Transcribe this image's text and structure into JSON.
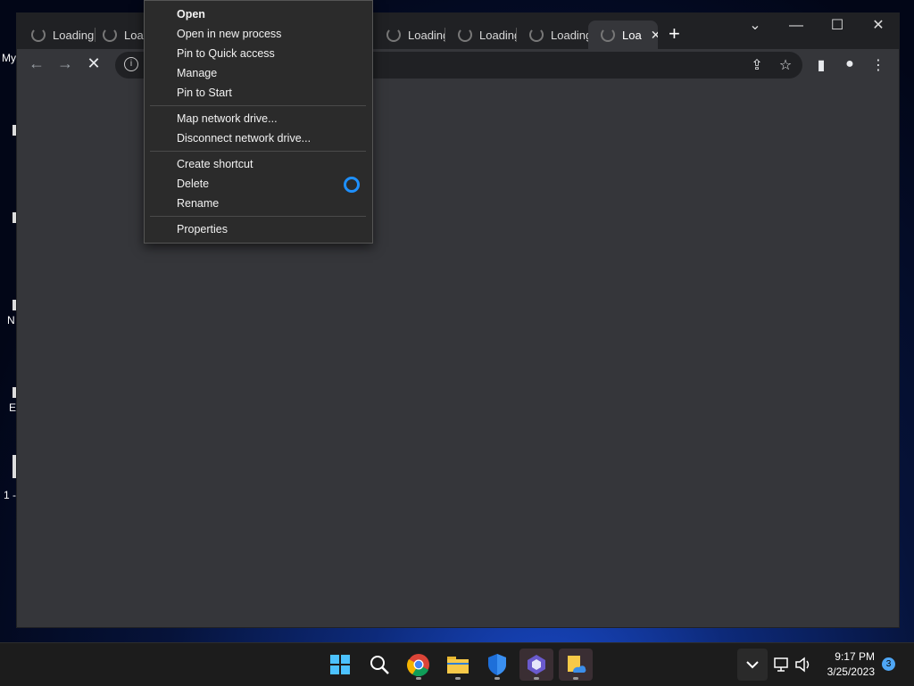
{
  "desktop": {
    "icon_labels": [
      "My",
      "N",
      "E",
      "1 -"
    ]
  },
  "browser": {
    "tabs": [
      {
        "label": "Loading"
      },
      {
        "label": "Load"
      },
      {
        "label": "Loading"
      },
      {
        "label": "Loading"
      },
      {
        "label": "Loading"
      },
      {
        "label": "Loa",
        "active": true
      }
    ],
    "new_tab_glyph": "+",
    "close_glyph": "✕",
    "window_controls": {
      "tab_search": "⌄",
      "minimize": "—",
      "maximize": "☐",
      "close": "✕"
    }
  },
  "toolbar": {
    "back_glyph": "←",
    "forward_glyph": "→",
    "stop_glyph": "✕",
    "info_glyph": "i"
  },
  "context_menu": {
    "groups": [
      [
        "Open",
        "Open in new process",
        "Pin to Quick access",
        "Manage",
        "Pin to Start"
      ],
      [
        "Map network drive...",
        "Disconnect network drive..."
      ],
      [
        "Create shortcut",
        "Delete",
        "Rename"
      ],
      [
        "Properties"
      ]
    ]
  },
  "taskbar": {
    "time": "9:17 PM",
    "date": "3/25/2023",
    "notification_count": "3",
    "apps": [
      "start-icon",
      "search-icon",
      "chrome-icon",
      "file-explorer-icon",
      "defender-icon",
      "app-icon",
      "onedrive-folder-icon"
    ]
  },
  "colors": {
    "accent": "#1e90ff",
    "browser_bg": "#35363a",
    "tabstrip_bg": "#202124",
    "menu_bg": "#2b2b2b"
  }
}
